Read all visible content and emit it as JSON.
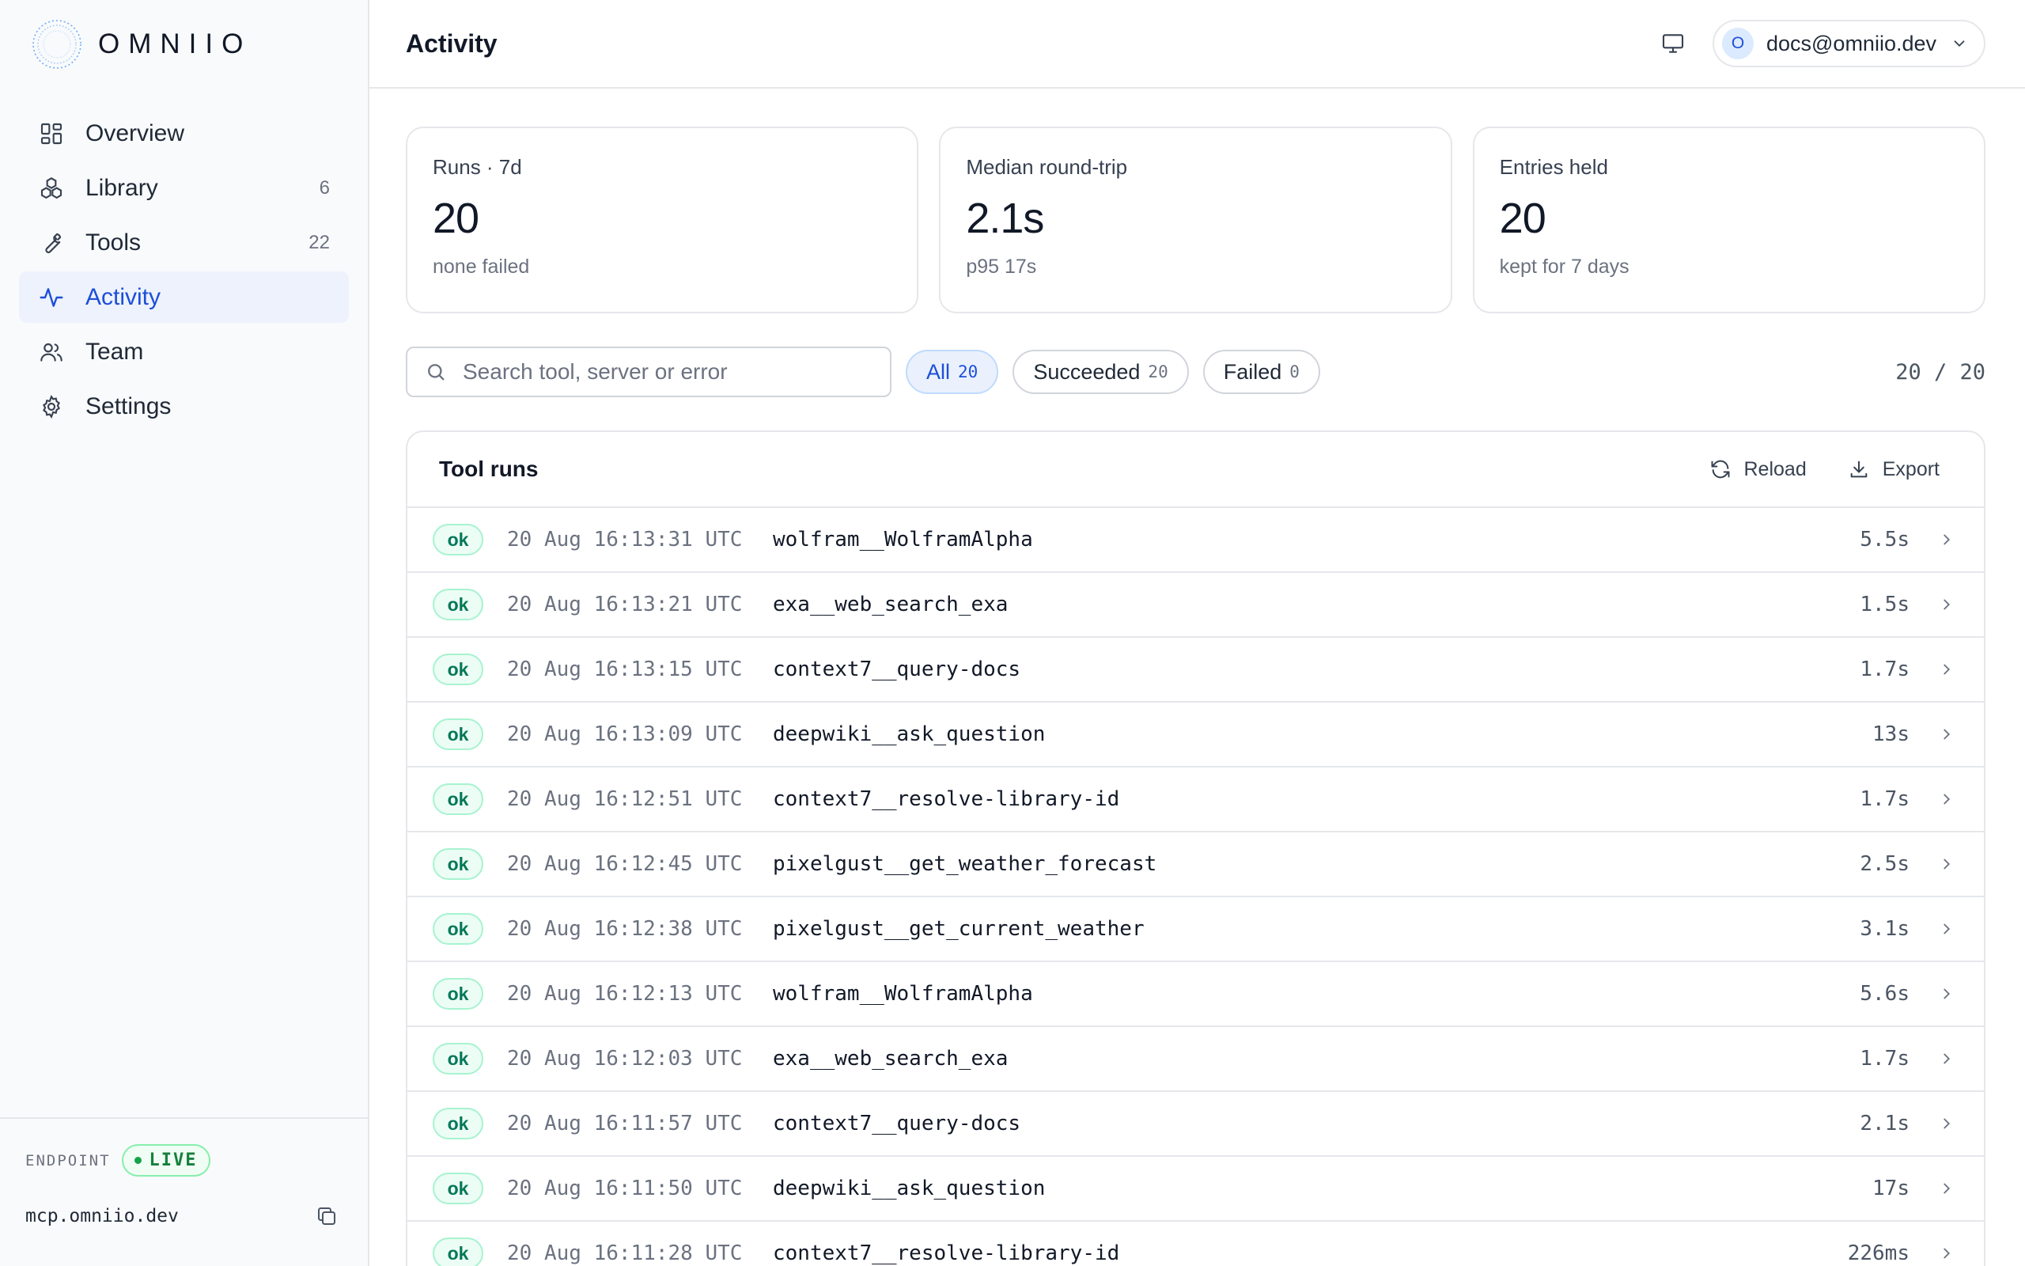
{
  "brand": {
    "name": "OMNIIO"
  },
  "nav": [
    {
      "label": "Overview",
      "icon": "overview-grid-icon",
      "count": ""
    },
    {
      "label": "Library",
      "icon": "library-boxes-icon",
      "count": "6"
    },
    {
      "label": "Tools",
      "icon": "wrench-icon",
      "count": "22"
    },
    {
      "label": "Activity",
      "icon": "activity-pulse-icon",
      "count": "",
      "active": true
    },
    {
      "label": "Team",
      "icon": "users-icon",
      "count": ""
    },
    {
      "label": "Settings",
      "icon": "gear-icon",
      "count": ""
    }
  ],
  "endpoint": {
    "label": "ENDPOINT",
    "status": "LIVE",
    "host": "mcp.omniio.dev"
  },
  "header": {
    "title": "Activity",
    "avatar_initial": "O",
    "email": "docs@omniio.dev"
  },
  "stats": [
    {
      "label": "Runs · 7d",
      "value": "20",
      "sub": "none failed"
    },
    {
      "label": "Median round-trip",
      "value": "2.1s",
      "sub": "p95 17s"
    },
    {
      "label": "Entries held",
      "value": "20",
      "sub": "kept for 7 days"
    }
  ],
  "search": {
    "placeholder": "Search tool, server or error",
    "value": ""
  },
  "filters": [
    {
      "label": "All",
      "count": "20",
      "active": true
    },
    {
      "label": "Succeeded",
      "count": "20"
    },
    {
      "label": "Failed",
      "count": "0"
    }
  ],
  "result_count": "20 / 20",
  "table": {
    "title": "Tool runs",
    "reload_label": "Reload",
    "export_label": "Export",
    "rows": [
      {
        "status": "ok",
        "time": "20 Aug 16:13:31 UTC",
        "tool": "wolfram__WolframAlpha",
        "duration": "5.5s"
      },
      {
        "status": "ok",
        "time": "20 Aug 16:13:21 UTC",
        "tool": "exa__web_search_exa",
        "duration": "1.5s"
      },
      {
        "status": "ok",
        "time": "20 Aug 16:13:15 UTC",
        "tool": "context7__query-docs",
        "duration": "1.7s"
      },
      {
        "status": "ok",
        "time": "20 Aug 16:13:09 UTC",
        "tool": "deepwiki__ask_question",
        "duration": "13s"
      },
      {
        "status": "ok",
        "time": "20 Aug 16:12:51 UTC",
        "tool": "context7__resolve-library-id",
        "duration": "1.7s"
      },
      {
        "status": "ok",
        "time": "20 Aug 16:12:45 UTC",
        "tool": "pixelgust__get_weather_forecast",
        "duration": "2.5s"
      },
      {
        "status": "ok",
        "time": "20 Aug 16:12:38 UTC",
        "tool": "pixelgust__get_current_weather",
        "duration": "3.1s"
      },
      {
        "status": "ok",
        "time": "20 Aug 16:12:13 UTC",
        "tool": "wolfram__WolframAlpha",
        "duration": "5.6s"
      },
      {
        "status": "ok",
        "time": "20 Aug 16:12:03 UTC",
        "tool": "exa__web_search_exa",
        "duration": "1.7s"
      },
      {
        "status": "ok",
        "time": "20 Aug 16:11:57 UTC",
        "tool": "context7__query-docs",
        "duration": "2.1s"
      },
      {
        "status": "ok",
        "time": "20 Aug 16:11:50 UTC",
        "tool": "deepwiki__ask_question",
        "duration": "17s"
      },
      {
        "status": "ok",
        "time": "20 Aug 16:11:28 UTC",
        "tool": "context7__resolve-library-id",
        "duration": "226ms"
      }
    ]
  },
  "colors": {
    "accent": "#1d4ed8",
    "active_bg": "#edf2fd",
    "ok_text": "#047857",
    "ok_bg": "#ecfdf5",
    "live": "#16a34a"
  }
}
